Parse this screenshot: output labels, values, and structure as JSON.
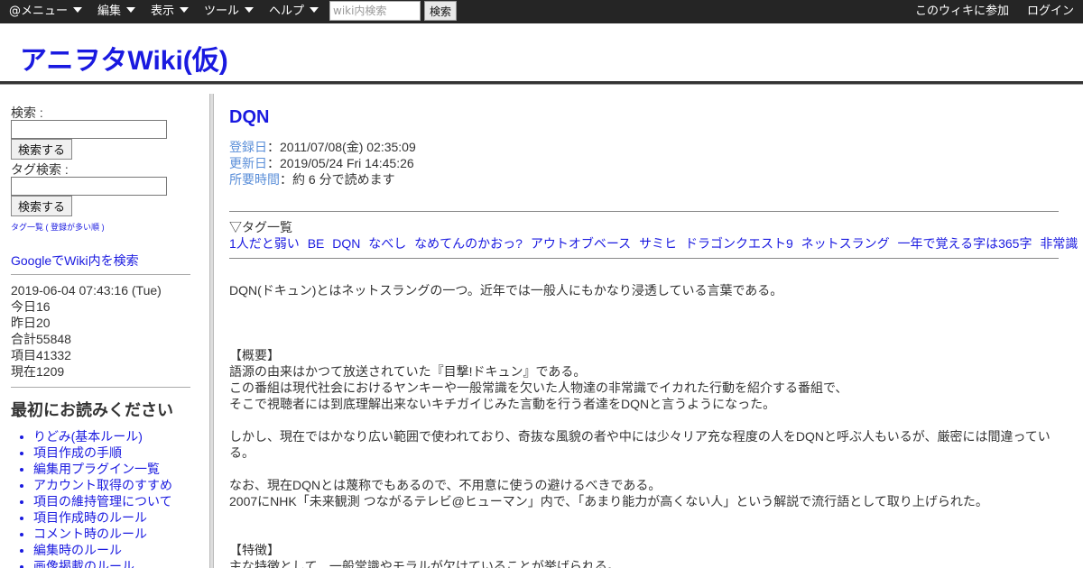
{
  "topbar": {
    "menus": [
      {
        "label": "@メニュー"
      },
      {
        "label": "編集"
      },
      {
        "label": "表示"
      },
      {
        "label": "ツール"
      },
      {
        "label": "ヘルプ"
      }
    ],
    "search_placeholder": "wiki内検索",
    "search_button": "検索",
    "join_label": "このウィキに参加",
    "login_label": "ログイン"
  },
  "header": {
    "site_title": "アニヲタWiki(仮)"
  },
  "sidebar": {
    "search_label": "検索 :",
    "search_button": "検索する",
    "tag_search_label": "タグ検索 :",
    "tag_search_button": "検索する",
    "tag_list_link": "タグ一覧",
    "tag_popular_link": "登録が多い順",
    "google_search": "GoogleでWiki内を検索",
    "datetime": "2019-06-04 07:43:16 (Tue)",
    "today": "今日16",
    "yesterday": "昨日20",
    "total": "合計55848",
    "items": "項目41332",
    "current": "現在1209",
    "read_first_heading": "最初にお読みください",
    "read_first_links": [
      "りどみ(基本ルール)",
      "項目作成の手順",
      "編集用プラグイン一覧",
      "アカウント取得のすすめ",
      "項目の維持管理について",
      "項目作成時のルール",
      "コメント時のルール",
      "編集時のルール",
      "画像掲載のルール"
    ]
  },
  "article": {
    "title": "DQN",
    "registered_label": "登録日",
    "registered_value": "：2011/07/08(金) 02:35:09",
    "updated_label": "更新日",
    "updated_value": "：2019/05/24 Fri 14:45:26",
    "reading_label": "所要時間",
    "reading_value": "：約 6 分で読めます",
    "tags_heading": "▽タグ一覧",
    "tags": [
      "1人だと弱い",
      "BE",
      "DQN",
      "なべし",
      "なめてんのかおっ?",
      "アウトオブベース",
      "サミヒ",
      "ドラゴンクエスト9",
      "ネットスラング",
      "一年で覚える字は365字",
      "非常識"
    ],
    "intro": "DQN(ドキュン)とはネットスラングの一つ。近年では一般人にもかなり浸透している言葉である。",
    "overview_heading": "【概要】",
    "overview_lines": [
      "語源の由来はかつて放送されていた『目撃!ドキュン』である。",
      "この番組は現代社会におけるヤンキーや一般常識を欠いた人物達の非常識でイカれた行動を紹介する番組で、",
      "そこで視聴者には到底理解出来ないキチガイじみた言動を行う者達をDQNと言うようになった。"
    ],
    "para2": "しかし、現在ではかなり広い範囲で使われており、奇抜な風貌の者や中には少々リア充な程度の人をDQNと呼ぶ人もいるが、厳密には間違っている。",
    "para3_lines": [
      "なお、現在DQNとは蔑称でもあるので、不用意に使うの避けるべきである。",
      "2007にNHK「未来観測 つながるテレビ@ヒューマン」内で、「あまり能力が高くない人」という解説で流行語として取り上げられた。"
    ],
    "features_heading": "【特徴】",
    "features_line": "主な特徴として、一般常識やモラルが欠けていることが挙げられる。"
  }
}
